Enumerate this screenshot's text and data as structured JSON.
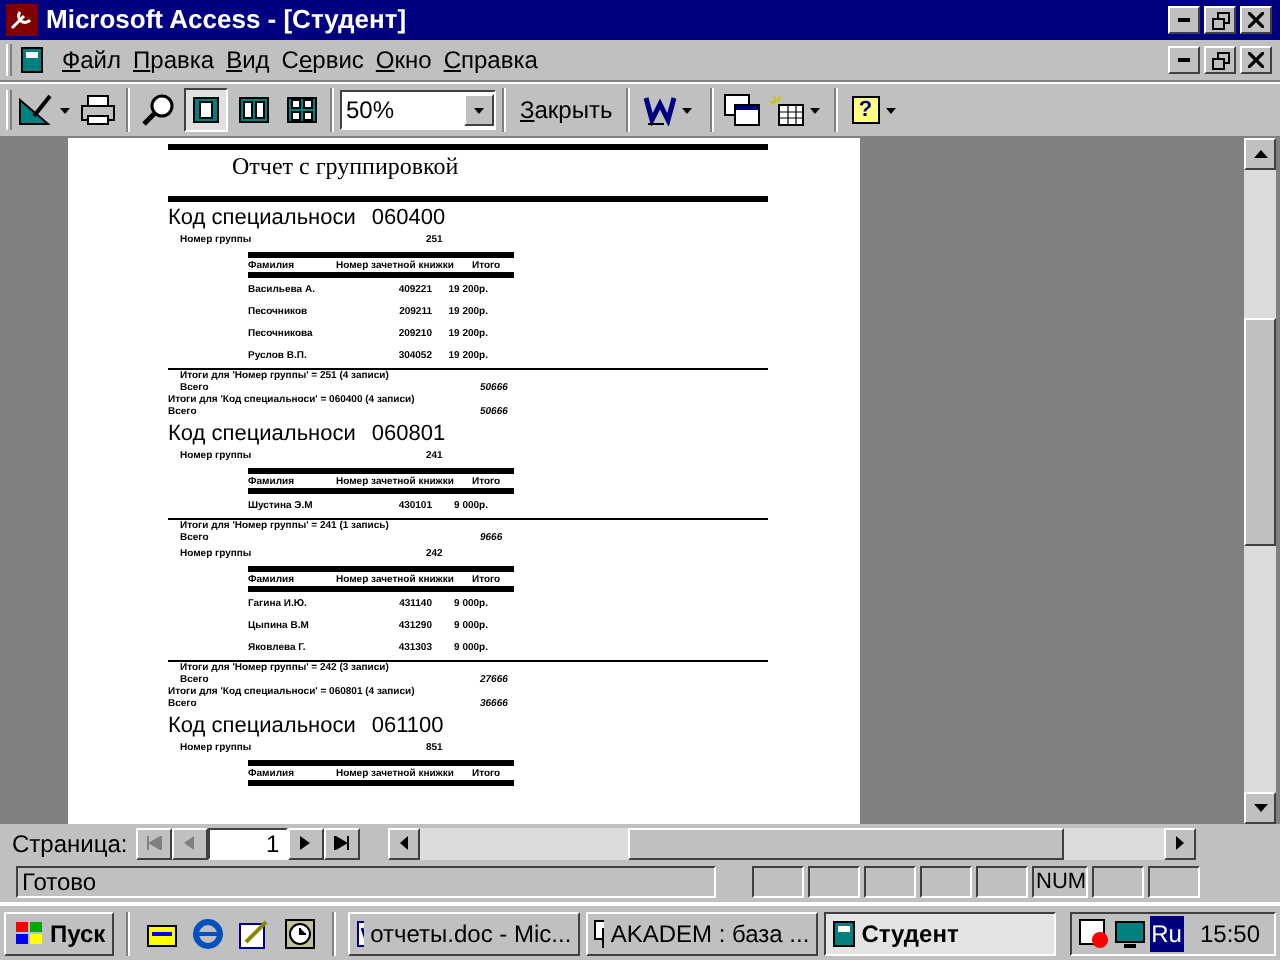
{
  "window": {
    "title": "Microsoft Access - [Студент]"
  },
  "menu": [
    {
      "hotkey": "Ф",
      "rest": "айл"
    },
    {
      "hotkey": "П",
      "rest": "равка"
    },
    {
      "hotkey": "В",
      "rest": "ид"
    },
    {
      "prefix": "С",
      "hotkey": "е",
      "rest": "рвис"
    },
    {
      "hotkey": "О",
      "rest": "кно"
    },
    {
      "hotkey": "С",
      "rest": "правка"
    }
  ],
  "toolbar": {
    "zoom": "50%",
    "close_hotkey": "З",
    "close_rest": "акрыть",
    "help_glyph": "?",
    "page_views": [
      {
        "selected": true
      },
      {
        "selected": false
      },
      {
        "selected": false
      }
    ]
  },
  "report": {
    "title": "Отчет с группировкой",
    "sections": [
      {
        "label": "Код специальноси",
        "code": "060400",
        "groups": [
          {
            "label": "Номер группы",
            "number": "251",
            "columns": [
              "Фамилия",
              "Номер зачетной книжки",
              "Итого"
            ],
            "rows": [
              [
                "Васильева А.",
                "409221",
                "19 200р."
              ],
              [
                "Песочников",
                "209211",
                "19 200р."
              ],
              [
                "Песочникова",
                "209210",
                "19 200р."
              ],
              [
                "Руслов В.П.",
                "304052",
                "19 200р."
              ]
            ],
            "summary": "Итоги для 'Номер группы' = 251 (4 записи)",
            "total_label": "Всего",
            "total": "50666"
          }
        ],
        "summary": "Итоги для 'Код специальноси' = 060400 (4 записи)",
        "total_label": "Всего",
        "total": "50666"
      },
      {
        "label": "Код специальноси",
        "code": "060801",
        "groups": [
          {
            "label": "Номер группы",
            "number": "241",
            "columns": [
              "Фамилия",
              "Номер зачетной книжки",
              "Итого"
            ],
            "rows": [
              [
                "Шустина Э.М",
                "430101",
                "9 000р."
              ]
            ],
            "summary": "Итоги для 'Номер группы' = 241 (1 запись)",
            "total_label": "Всего",
            "total": "9666"
          },
          {
            "label": "Номер группы",
            "number": "242",
            "columns": [
              "Фамилия",
              "Номер зачетной книжки",
              "Итого"
            ],
            "rows": [
              [
                "Гагина И.Ю.",
                "431140",
                "9 000р."
              ],
              [
                "Цыпина В.М",
                "431290",
                "9 000р."
              ],
              [
                "Яковлева Г.",
                "431303",
                "9 000р."
              ]
            ],
            "summary": "Итоги для 'Номер группы' = 242 (3 записи)",
            "total_label": "Всего",
            "total": "27666"
          }
        ],
        "summary": "Итоги для 'Код специальноси' = 060801 (4 записи)",
        "total_label": "Всего",
        "total": "36666"
      },
      {
        "label": "Код специальноси",
        "code": "061100",
        "groups": [
          {
            "label": "Номер группы",
            "number": "851",
            "columns": [
              "Фамилия",
              "Номер зачетной книжки",
              "Итого"
            ]
          }
        ]
      }
    ]
  },
  "page_nav": {
    "label": "Страница:",
    "page": "1"
  },
  "status_bar": {
    "text": "Готово",
    "indicator": "NUM"
  },
  "taskbar": {
    "start": "Пуск",
    "tasks": [
      {
        "label": "отчеты.doc - Mic...",
        "kind": "doc",
        "selected": false
      },
      {
        "label": "AKADEM : база ...",
        "kind": "db",
        "selected": false
      },
      {
        "label": "Студент",
        "kind": "report",
        "selected": true
      }
    ],
    "language": "Ru",
    "clock": "15:50"
  }
}
